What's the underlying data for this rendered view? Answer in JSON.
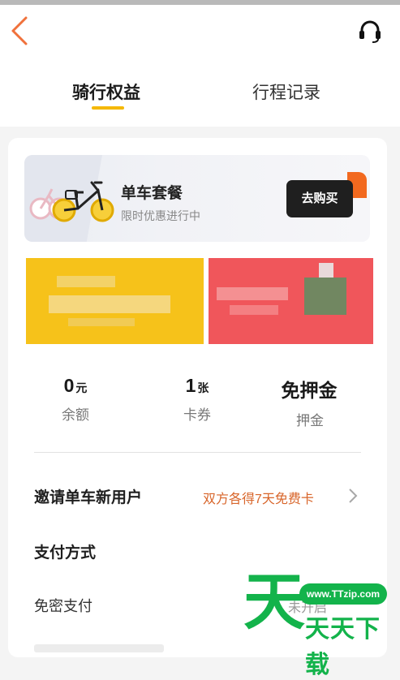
{
  "tabs": [
    {
      "label": "骑行权益",
      "active": true
    },
    {
      "label": "行程记录",
      "active": false
    }
  ],
  "promo": {
    "title": "单车套餐",
    "subtitle": "限时优惠进行中",
    "button_label": "去购买"
  },
  "stats": [
    {
      "value": "0",
      "unit": "元",
      "label": "余额"
    },
    {
      "value": "1",
      "unit": "张",
      "label": "卡券"
    },
    {
      "value": "免押金",
      "unit": "",
      "label": "押金"
    }
  ],
  "invite": {
    "label": "邀请单车新用户",
    "reward": "双方各得7天免费卡"
  },
  "payment": {
    "title": "支付方式",
    "no_password_label": "免密支付",
    "no_password_status": "未开启"
  },
  "watermark": {
    "glyph": "天",
    "url": "www.TTzip.com",
    "text": "天天下载"
  },
  "icons": {
    "back": "back-arrow-icon",
    "support": "headset-icon",
    "bike": "bike-icon",
    "chevron": "chevron-right-icon"
  },
  "colors": {
    "accent": "#f5b800",
    "reward_text": "#d8652a",
    "button_dark": "#1f1f1f",
    "watermark_green": "#13b34b"
  }
}
